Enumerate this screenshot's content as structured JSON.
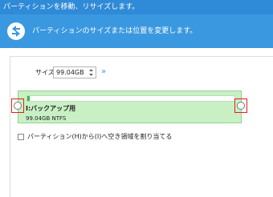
{
  "window": {
    "title": "パーティションを移動、リサイズします。"
  },
  "header": {
    "subtitle": "パーティションのサイズまたは位置を変更します。",
    "icon": "move-resize-icon"
  },
  "size": {
    "label": "サイズ:",
    "value": "99.04GB",
    "spinner_icon": "spin-updown-icon",
    "more_label": "»"
  },
  "partition": {
    "name": "I:バックアップ用",
    "info": "99.04GB NTFS",
    "used_fraction": 0.01,
    "fill_color": "#c9f0c5",
    "handle_color": "#e02020"
  },
  "option": {
    "label": "パーティション(H)から(I)へ空き領域を割り当てる",
    "checked": false
  },
  "colors": {
    "title_bar": "#2f8ad7",
    "header": "#3a98e0"
  }
}
